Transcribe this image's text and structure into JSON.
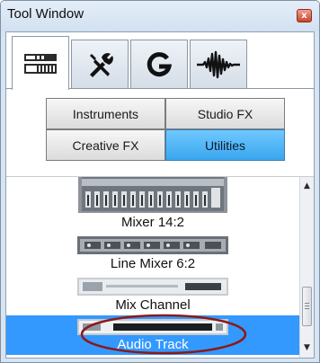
{
  "window": {
    "title": "Tool Window",
    "close_glyph": "x"
  },
  "tabs": [
    {
      "name": "mixer-tab-icon",
      "active": true
    },
    {
      "name": "tools-tab-icon",
      "active": false
    },
    {
      "name": "g-tab-icon",
      "active": false
    },
    {
      "name": "waveform-tab-icon",
      "active": false
    }
  ],
  "categories": {
    "instruments": "Instruments",
    "studio_fx": "Studio FX",
    "creative_fx": "Creative FX",
    "utilities": "Utilities",
    "selected": "Utilities"
  },
  "list": {
    "items": [
      {
        "label": "Mixer 14:2"
      },
      {
        "label": "Line Mixer 6:2"
      },
      {
        "label": "Mix Channel"
      },
      {
        "label": "Audio Track",
        "selected": true
      }
    ]
  },
  "colors": {
    "selection": "#3399ff",
    "highlight_circle": "#8b1a1a"
  }
}
